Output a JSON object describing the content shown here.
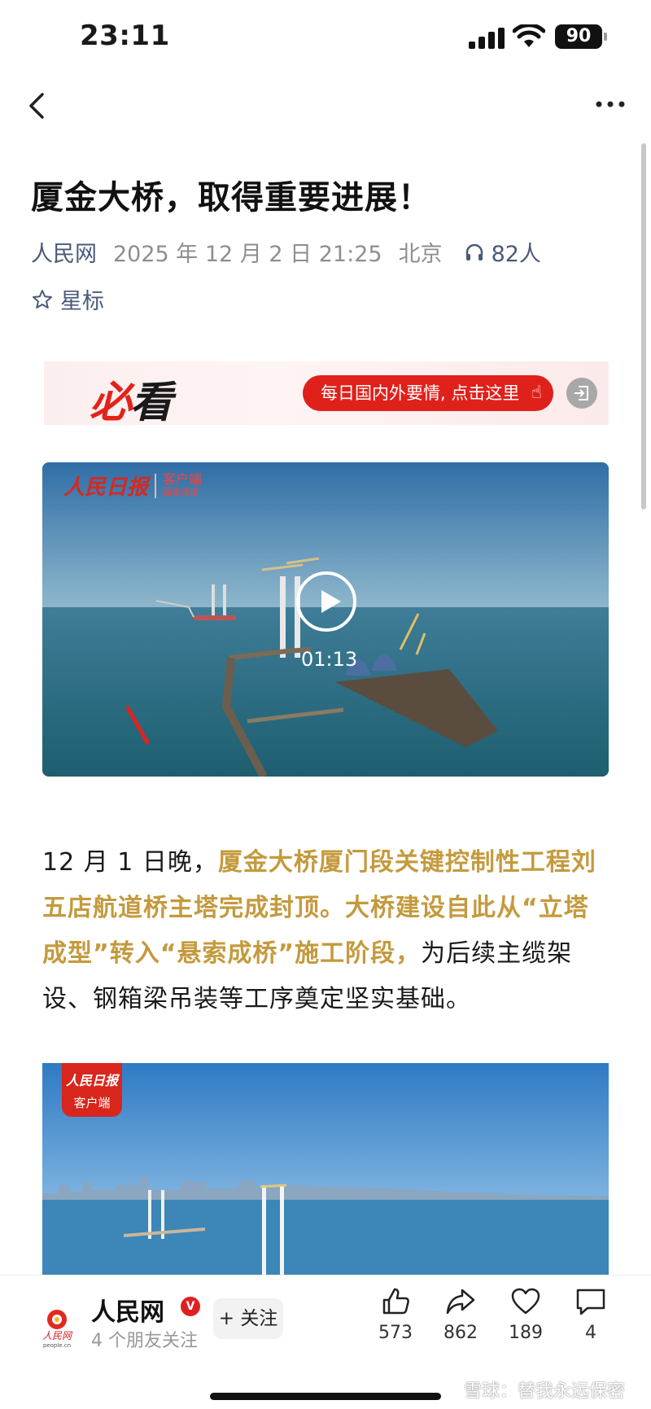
{
  "status_bar": {
    "time": "23:11",
    "battery": "90"
  },
  "article": {
    "title": "厦金大桥，取得重要进展！",
    "source": "人民网",
    "date": "2025 年 12 月 2 日  21:25",
    "location": "北京",
    "listeners": "82人",
    "bookmark_label": "星标"
  },
  "banner": {
    "logo_part1": "必",
    "logo_part2": "看",
    "cta": "每日国内外要情, 点击这里"
  },
  "video": {
    "logo_script": "人民日报",
    "logo_client": "客户端",
    "logo_channel": "福建频道",
    "duration": "01:13"
  },
  "paragraph": {
    "lead": "12 月 1 日晚，",
    "highlight1": "厦金大桥厦门段关键控制性工程刘五店航道桥主塔完成封顶。大桥建设自此从“立塔成型”转入“悬索成桥”施工阶段，",
    "rest": "为后续主缆架设、钢箱梁吊装等工序奠定坚实基础。"
  },
  "image2": {
    "badge_script": "人民日报",
    "badge_client": "客户端"
  },
  "footer": {
    "author": "人民网",
    "verified": "V",
    "followers": "4 个朋友关注",
    "follow_label": "+ 关注",
    "likes": "573",
    "shares": "862",
    "favorites": "189",
    "comments": "4",
    "watermark": "雪球：替我永远保密"
  },
  "icons": [
    "back-icon",
    "more-icon",
    "headphones-icon",
    "star-icon",
    "play-icon",
    "like-icon",
    "share-icon",
    "heart-icon",
    "comment-icon"
  ]
}
